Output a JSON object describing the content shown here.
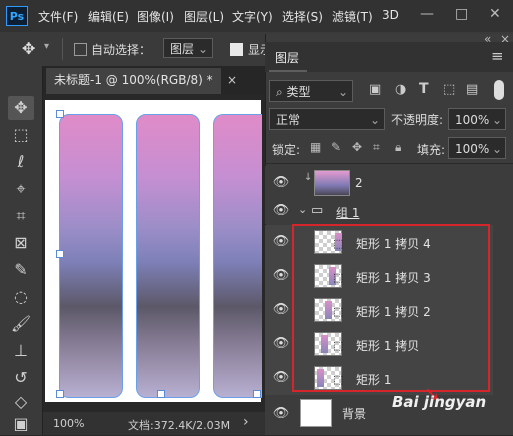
{
  "menubar": {
    "logo": "Ps",
    "items": [
      "文件(F)",
      "编辑(E)",
      "图像(I)",
      "图层(L)",
      "文字(Y)",
      "选择(S)",
      "滤镜(T)",
      "3D"
    ],
    "window_buttons": [
      "—",
      "□",
      "✕"
    ]
  },
  "options": {
    "auto_select_label": "自动选择：",
    "target_value": "图层",
    "show_transform_label": "显示"
  },
  "document": {
    "tab_title": "未标题-1 @ 100%(RGB/8) *",
    "close_label": "×"
  },
  "status": {
    "zoom": "100%",
    "doc_info": "文档:372.4K/2.03M",
    "arrow": "›"
  },
  "layers_panel": {
    "title": "图层",
    "collapse_glyph": "«",
    "close_glyph": "×",
    "menu_glyph": "≡",
    "filter_value": "类型",
    "blend_mode": "正常",
    "opacity_label": "不透明度:",
    "opacity_value": "100%",
    "lock_label": "锁定:",
    "fill_label": "填充:",
    "fill_value": "100%",
    "layers": [
      {
        "name": "2"
      },
      {
        "name": "组 1"
      },
      {
        "name": "矩形 1 拷贝 4"
      },
      {
        "name": "矩形 1 拷贝 3"
      },
      {
        "name": "矩形 1 拷贝 2"
      },
      {
        "name": "矩形 1 拷贝"
      },
      {
        "name": "矩形 1"
      },
      {
        "name": "背景"
      }
    ]
  },
  "watermark": {
    "text": "Bai jingyan"
  },
  "colors": {
    "highlight": "#d6262c",
    "accent": "#31a8ff"
  }
}
